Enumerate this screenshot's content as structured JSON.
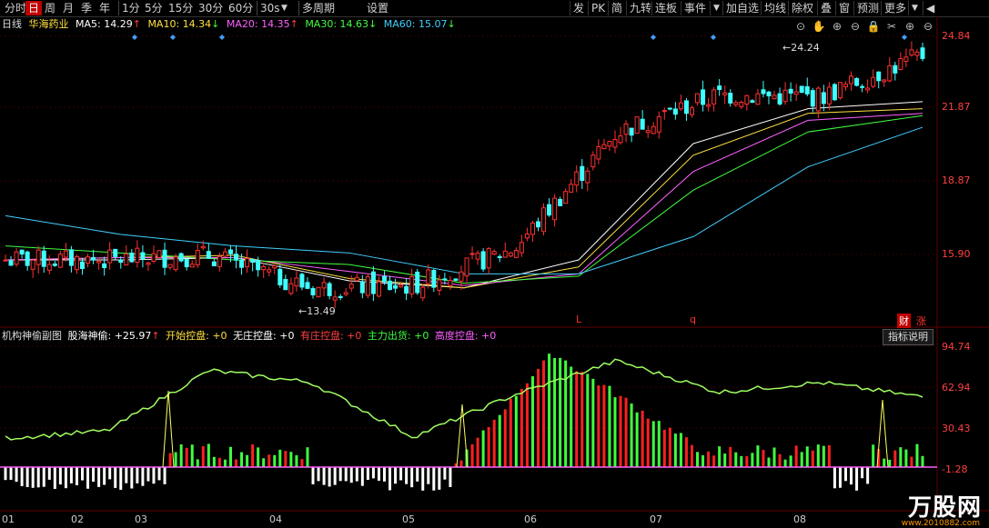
{
  "toolbar": {
    "left_items": [
      "分时",
      "日",
      "周",
      "月",
      "季",
      "年",
      "1分",
      "5分",
      "15分",
      "30分",
      "60分",
      "30s",
      "多周期",
      "设置"
    ],
    "active": "日",
    "dropdown_icon": "▼",
    "right_items": [
      "发",
      "PK",
      "简",
      "九转",
      "连板",
      "事件",
      "加自选",
      "均线",
      "除权",
      "叠",
      "窗",
      "预测",
      "更多"
    ],
    "nav_icon": "◀"
  },
  "stock": {
    "period": "日线",
    "name": "华海药业",
    "ma": [
      {
        "label": "MA5: 14.29",
        "arrow": "↑",
        "color": "#ffffff"
      },
      {
        "label": "MA10: 14.34",
        "arrow": "↓",
        "color": "#ffe040"
      },
      {
        "label": "MA20: 14.35",
        "arrow": "↑",
        "color": "#ff60ff"
      },
      {
        "label": "MA30: 14.63",
        "arrow": "↓",
        "color": "#40ff40"
      },
      {
        "label": "MA60: 15.07",
        "arrow": "↓",
        "color": "#40d0ff"
      }
    ]
  },
  "icons": [
    "target-icon",
    "hand-icon",
    "plus-icon",
    "minus-icon",
    "lock-icon",
    "scissors-icon",
    "zoom-in-icon",
    "zoom-out-icon"
  ],
  "price_axis": [
    "24.84",
    "21.87",
    "18.87",
    "15.90"
  ],
  "peak_high": "24.24",
  "peak_low": "13.49",
  "labels": {
    "L": "L",
    "q": "q",
    "cai": "财",
    "zhang": "涨"
  },
  "indicator": {
    "title": "机构神偷副图",
    "items": [
      {
        "label": "股海神偷: +25.97",
        "arrow": "↑",
        "color": "#ffffff"
      },
      {
        "label": "开始控盘: +0",
        "arrow": "",
        "color": "#ffe040"
      },
      {
        "label": "无庄控盘: +0",
        "arrow": "",
        "color": "#ffffff"
      },
      {
        "label": "有庄控盘: +0",
        "arrow": "",
        "color": "#ff4040"
      },
      {
        "label": "主力出货: +0",
        "arrow": "",
        "color": "#40ff40"
      },
      {
        "label": "高度控盘: +0",
        "arrow": "",
        "color": "#ff60ff"
      }
    ],
    "explain_button": "指标说明",
    "axis": [
      "94.74",
      "62.94",
      "30.43",
      "-1.28"
    ]
  },
  "months": [
    "01",
    "02",
    "03",
    "04",
    "05",
    "06",
    "07",
    "08"
  ],
  "watermark": {
    "text": "万股网",
    "url": "www.2010882.com"
  },
  "chart_data": {
    "type": "candlestick",
    "months": [
      "01",
      "02",
      "03",
      "04",
      "05",
      "06",
      "07",
      "08"
    ],
    "series": [
      {
        "name": "MA5",
        "values": [
          15.5,
          15.5,
          15.6,
          14.6,
          14.3,
          15.5,
          20.5,
          22.0,
          22.3
        ]
      },
      {
        "name": "MA10",
        "values": [
          15.5,
          15.6,
          15.7,
          14.7,
          14.3,
          15.2,
          20.0,
          21.8,
          22.0
        ]
      },
      {
        "name": "MA20",
        "values": [
          15.5,
          15.6,
          15.6,
          15.0,
          14.4,
          14.9,
          19.3,
          21.5,
          21.8
        ]
      },
      {
        "name": "MA30",
        "values": [
          16.1,
          15.8,
          15.5,
          15.3,
          14.5,
          14.8,
          18.5,
          21.0,
          21.7
        ]
      },
      {
        "name": "MA60",
        "values": [
          17.4,
          16.6,
          16.1,
          15.8,
          14.9,
          14.9,
          16.5,
          19.5,
          21.2
        ]
      }
    ],
    "close": [
      15.5,
      15.5,
      15.7,
      14.3,
      14.4,
      16.0,
      21.0,
      22.6,
      22.5,
      24.3
    ],
    "ylim": [
      13.0,
      25.5
    ],
    "indicator_line": [
      24,
      30,
      80,
      70,
      25,
      60,
      88,
      62,
      70,
      58
    ]
  }
}
